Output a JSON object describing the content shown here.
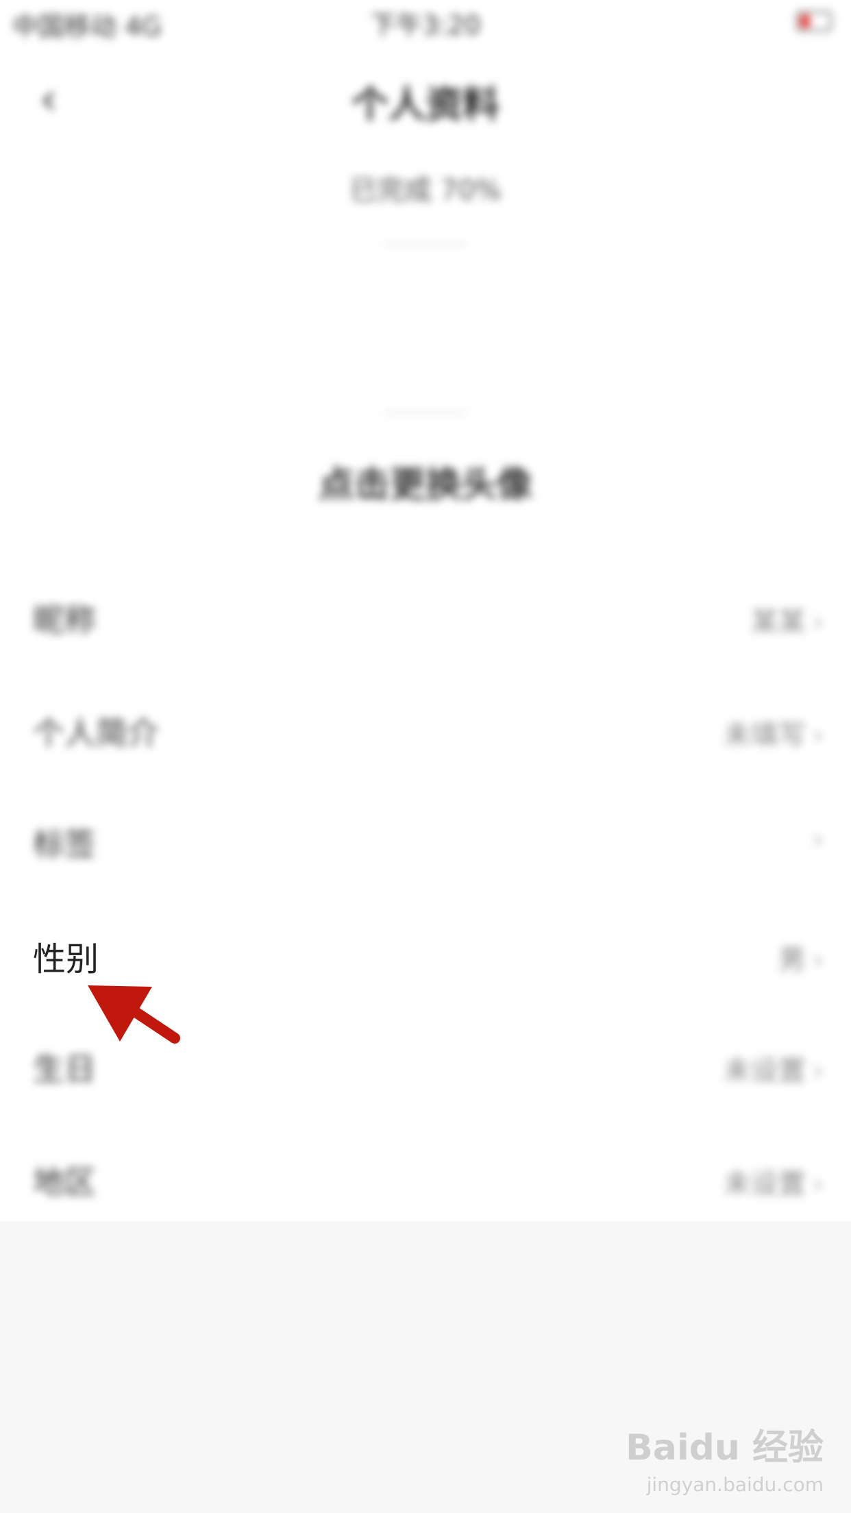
{
  "status_bar": {
    "carrier": "中国移动 4G",
    "time": "下午3:20"
  },
  "nav": {
    "back_glyph": "‹",
    "title": "个人资料",
    "completion": "已完成 70%"
  },
  "avatar_hint": "点击更换头像",
  "rows": [
    {
      "label": "昵称",
      "value": "某某"
    },
    {
      "label": "个人简介",
      "value": "未填写"
    },
    {
      "label": "标签",
      "value": ""
    },
    {
      "label": "性别",
      "value": "男"
    },
    {
      "label": "生日",
      "value": "未设置"
    },
    {
      "label": "地区",
      "value": "未设置"
    }
  ],
  "watermark": {
    "brand": "Baidu 经验",
    "url": "jingyan.baidu.com"
  },
  "colors": {
    "annotation_arrow": "#c0180c",
    "battery_low": "#e53935"
  }
}
